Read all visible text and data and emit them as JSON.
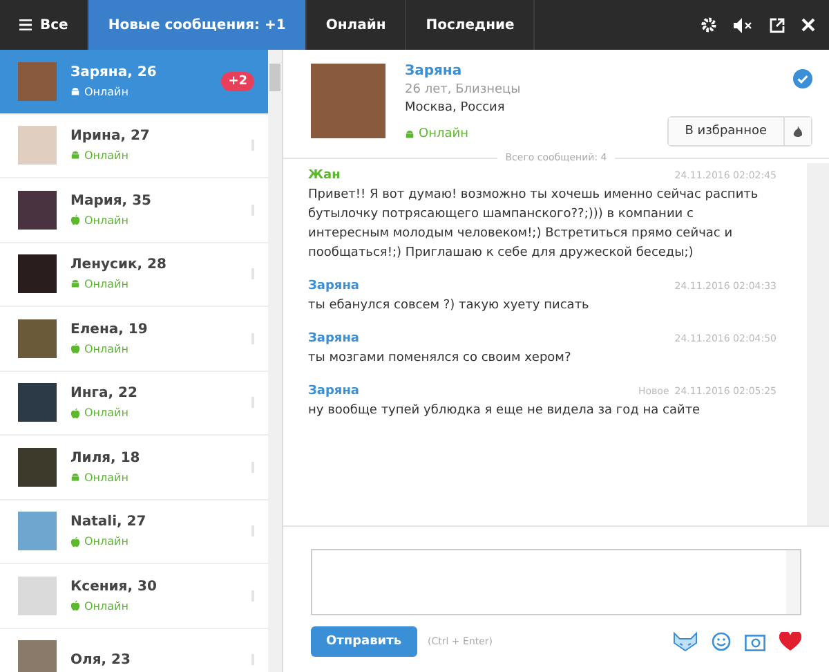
{
  "topbar": {
    "menu_label": "Все",
    "tabs": [
      {
        "label": "Новые сообщения: +1",
        "selected": true
      },
      {
        "label": "Онлайн",
        "selected": false
      },
      {
        "label": "Последние",
        "selected": false
      }
    ]
  },
  "contacts": [
    {
      "name": "Заряна, 26",
      "status": "Онлайн",
      "kind": "android",
      "badge": "+2",
      "selected": true
    },
    {
      "name": "Ирина, 27",
      "status": "Онлайн",
      "kind": "android",
      "selected": false
    },
    {
      "name": "Мария, 35",
      "status": "Онлайн",
      "kind": "apple",
      "selected": false
    },
    {
      "name": "Ленусик, 28",
      "status": "Онлайн",
      "kind": "android",
      "selected": false
    },
    {
      "name": "Елена, 19",
      "status": "Онлайн",
      "kind": "apple",
      "selected": false
    },
    {
      "name": "Инга, 22",
      "status": "Онлайн",
      "kind": "apple",
      "selected": false
    },
    {
      "name": "Лиля, 18",
      "status": "Онлайн",
      "kind": "android",
      "selected": false
    },
    {
      "name": "Natali, 27",
      "status": "Онлайн",
      "kind": "apple",
      "selected": false
    },
    {
      "name": "Ксения, 30",
      "status": "Онлайн",
      "kind": "apple",
      "selected": false
    },
    {
      "name": "Оля, 23",
      "selected": false
    }
  ],
  "profile": {
    "name": "Заряна",
    "details": "26 лет, Близнецы",
    "location": "Москва, Россия",
    "status": "Онлайн",
    "favorite_button": "В избранное"
  },
  "messages_total": "Всего сообщений: 4",
  "messages": [
    {
      "author": "Жан",
      "kind": "incoming",
      "time": "24.11.2016 02:02:45",
      "text": "Привет!! Я вот думаю! возможно ты хочешь именно сейчас распить бутылочку потрясающего шампанского??;))) в компании с интересным молодым человеком!;) Встретиться прямо сейчас и пообщаться!;) Приглашаю к себе для дружеской беседы;)"
    },
    {
      "author": "Заряна",
      "kind": "outgoing",
      "time": "24.11.2016 02:04:33",
      "text": "ты ебанулся совсем ?) такую хуету писать"
    },
    {
      "author": "Заряна",
      "kind": "outgoing",
      "time": "24.11.2016 02:04:50",
      "text": "ты мозгами поменялся со своим хером?"
    },
    {
      "author": "Заряна",
      "kind": "outgoing",
      "new_label": "Новое",
      "time": "24.11.2016 02:05:25",
      "text": "ну вообще тупей ублюдка я еще не видела за год на сайте"
    }
  ],
  "composer": {
    "send_button": "Отправить",
    "hint": "(Ctrl + Enter)"
  }
}
